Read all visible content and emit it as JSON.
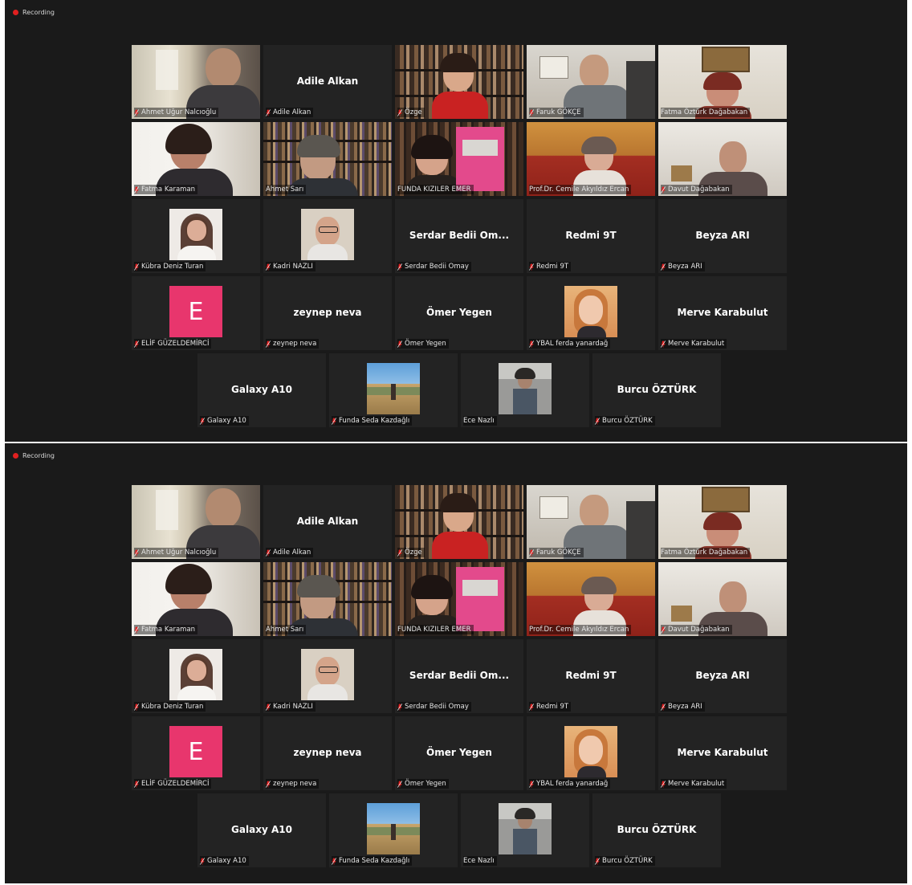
{
  "recording_label": "Recording",
  "initial_label": "E",
  "participants": {
    "ahmet_ugur": "Ahmet Uğur Nalcıoğlu",
    "adile_label": "Adile Alkan",
    "adile_big": "Adile Alkan",
    "ozge": "Özge",
    "faruk": "Faruk GÖKÇE",
    "fatma_ozturk": "Fatma Öztürk Dağabakan",
    "fatma_karaman": "Fatma Karaman",
    "ahmet_sari": "Ahmet Sarı",
    "funda_emer": "FUNDA KIZILER EMER",
    "cemile": "Prof.Dr. Cemile Akyıldız Ercan",
    "davut": "Davut Dağabakan",
    "kubra": "Kübra Deniz Turan",
    "kadri": "Kadri NAZLI",
    "serdar_big": "Serdar Bedii Om...",
    "serdar_label": "Serdar Bedii Omay",
    "redmi_big": "Redmi 9T",
    "redmi_label": "Redmi 9T",
    "beyza_big": "Beyza ARI",
    "beyza_label": "Beyza ARI",
    "elif": "ELİF GÜZELDEMİRCİ",
    "zeynep_big": "zeynep neva",
    "zeynep_label": "zeynep neva",
    "omer_big": "Ömer Yegen",
    "omer_label": "Ömer Yegen",
    "ferda": "YBAL ferda yanardağ",
    "merve_big": "Merve Karabulut",
    "merve_label": "Merve Karabulut",
    "galaxy_big": "Galaxy A10",
    "galaxy_label": "Galaxy A10",
    "funda_seda": "Funda Seda Kazdağlı",
    "ece": "Ece Nazlı",
    "burcu_big": "Burcu ÖZTÜRK",
    "burcu_label": "Burcu ÖZTÜRK"
  },
  "colors": {
    "background": "#1a1a1a",
    "tile": "#232323",
    "active_speaker_border": "#d6e43a",
    "recording_dot": "#e02020",
    "muted_icon": "#e02020",
    "avatar": "#e8366d"
  }
}
